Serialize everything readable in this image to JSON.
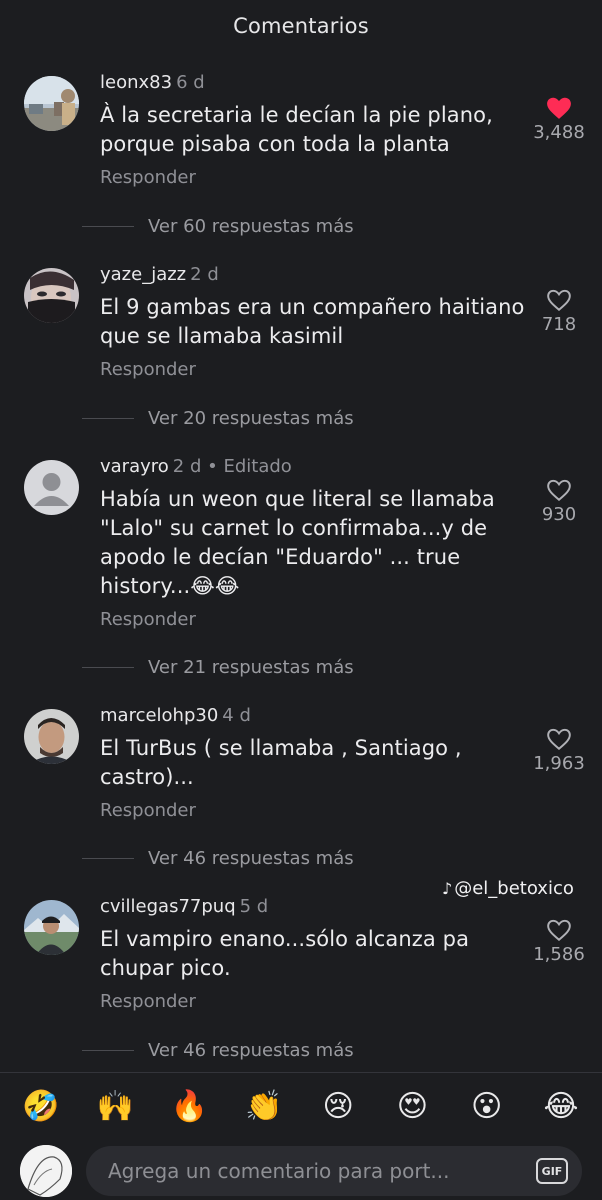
{
  "header": {
    "title": "Comentarios"
  },
  "comments": [
    {
      "user": "leonx83",
      "time": "6 d",
      "text": "À la secretaria le decían la pie plano, porque pisaba con toda la planta",
      "reply": "Responder",
      "likes": "3,488",
      "liked": true,
      "replies_label": "Ver 60 respuestas más",
      "avatar_icon": "landscape-photo-avatar"
    },
    {
      "user": "yaze_jazz",
      "time": "2 d",
      "text": "El 9 gambas era un compañero haitiano que se llamaba kasimil",
      "reply": "Responder",
      "likes": "718",
      "liked": false,
      "replies_label": "Ver 20 respuestas más",
      "avatar_icon": "masked-face-avatar"
    },
    {
      "user": "varayro",
      "time": "2 d • Editado",
      "text": "Había un weon que literal se llamaba \"Lalo\"  su carnet lo confirmaba...y de apodo le decían \"Eduardo\" ... true history...😂😂",
      "reply": "Responder",
      "likes": "930",
      "liked": false,
      "replies_label": "Ver 21 respuestas más",
      "avatar_icon": "default-user-avatar"
    },
    {
      "user": "marcelohp30",
      "time": "4 d",
      "text": "El TurBus ( se llamaba , Santiago , castro)...",
      "reply": "Responder",
      "likes": "1,963",
      "liked": false,
      "replies_label": "Ver 46 respuestas más",
      "avatar_icon": "man-portrait-avatar"
    },
    {
      "user": "cvillegas77puq",
      "time": "5 d",
      "text": "El vampiro enano...sólo alcanza pa chupar pico.",
      "reply": "Responder",
      "likes": "1,586",
      "liked": false,
      "replies_label": "Ver 46 respuestas más",
      "avatar_icon": "outdoor-portrait-avatar"
    }
  ],
  "watermark": {
    "icon": "tiktok-icon",
    "handle": "@el_betoxico"
  },
  "emoji_bar": [
    "🤣",
    "🙌",
    "🔥",
    "👏",
    "😢",
    "😍",
    "😮",
    "😂"
  ],
  "composer": {
    "placeholder": "Agrega un comentario para port...",
    "gif_label": "GIF"
  },
  "colors": {
    "background": "#1c1d20",
    "liked_heart": "#fe2c55",
    "muted_text": "#8f9096"
  }
}
